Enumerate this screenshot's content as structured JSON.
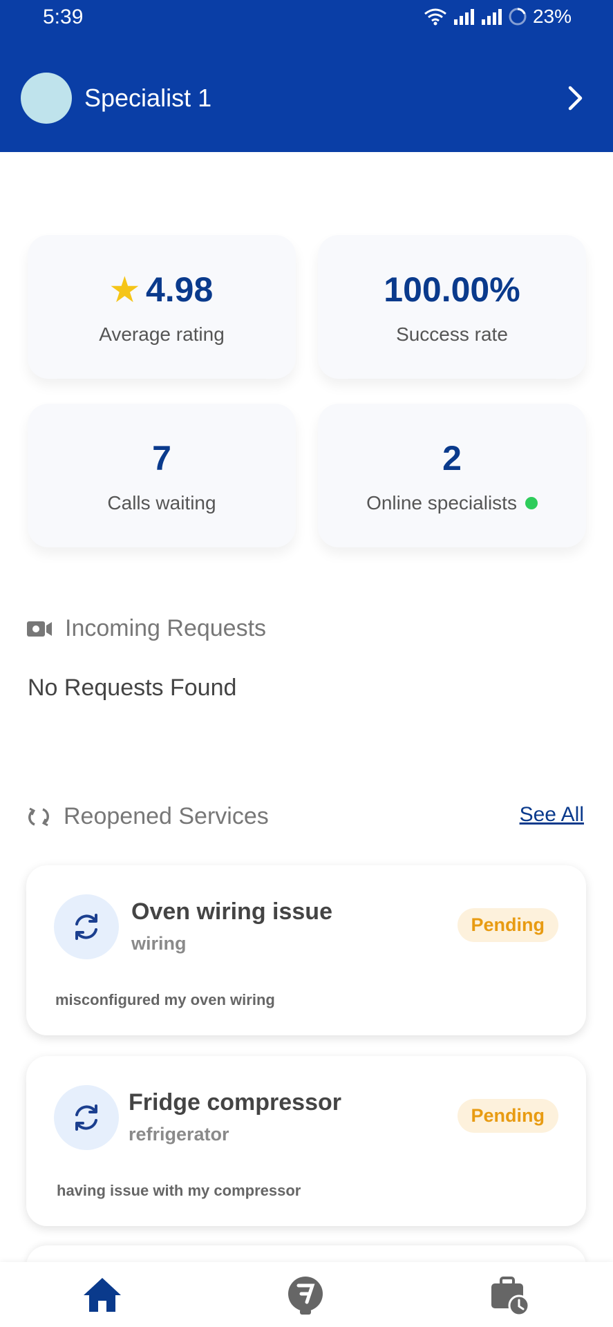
{
  "status_bar": {
    "time": "5:39",
    "battery": "23%"
  },
  "header": {
    "name": "Specialist 1"
  },
  "stats": {
    "avg_rating": {
      "value": "4.98",
      "label": "Average rating"
    },
    "success_rate": {
      "value": "100.00%",
      "label": "Success rate"
    },
    "calls_waiting": {
      "value": "7",
      "label": "Calls waiting"
    },
    "online_specialists": {
      "value": "2",
      "label": "Online specialists"
    }
  },
  "incoming": {
    "title": "Incoming Requests",
    "empty": "No Requests Found"
  },
  "reopened": {
    "title": "Reopened Services",
    "see_all": "See All",
    "items": [
      {
        "title": "Oven wiring issue",
        "category": "wiring",
        "status": "Pending",
        "description": "misconfigured my oven wiring"
      },
      {
        "title": "Fridge compressor",
        "category": "refrigerator",
        "status": "Pending",
        "description": "having issue with my compressor"
      }
    ]
  },
  "colors": {
    "header": "#0a3ea6",
    "accent": "#0a3a8c",
    "pending": "#e89b12",
    "online": "#2ecc5b"
  },
  "icons": {
    "nav": [
      "home-icon",
      "ticket-icon",
      "briefcase-clock-icon"
    ]
  }
}
